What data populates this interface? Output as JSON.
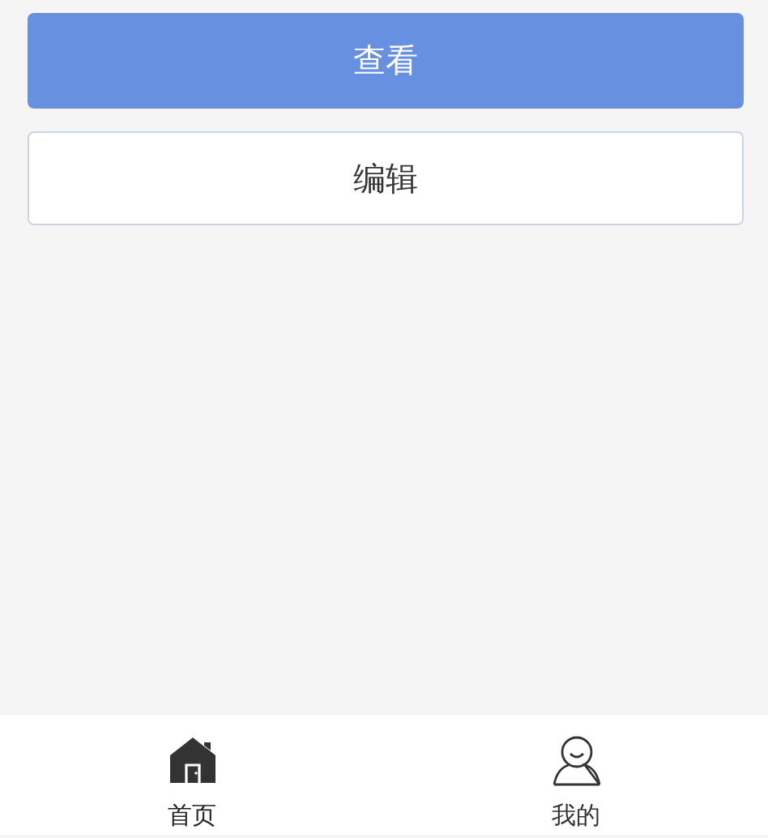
{
  "buttons": [
    {
      "label": "查看",
      "kind": "primary"
    },
    {
      "label": "编辑",
      "kind": "outline"
    }
  ],
  "tab_bar": [
    {
      "label": "首页",
      "kind": "home",
      "selected": true
    },
    {
      "label": "我的",
      "kind": "profile",
      "selected": false
    }
  ]
}
